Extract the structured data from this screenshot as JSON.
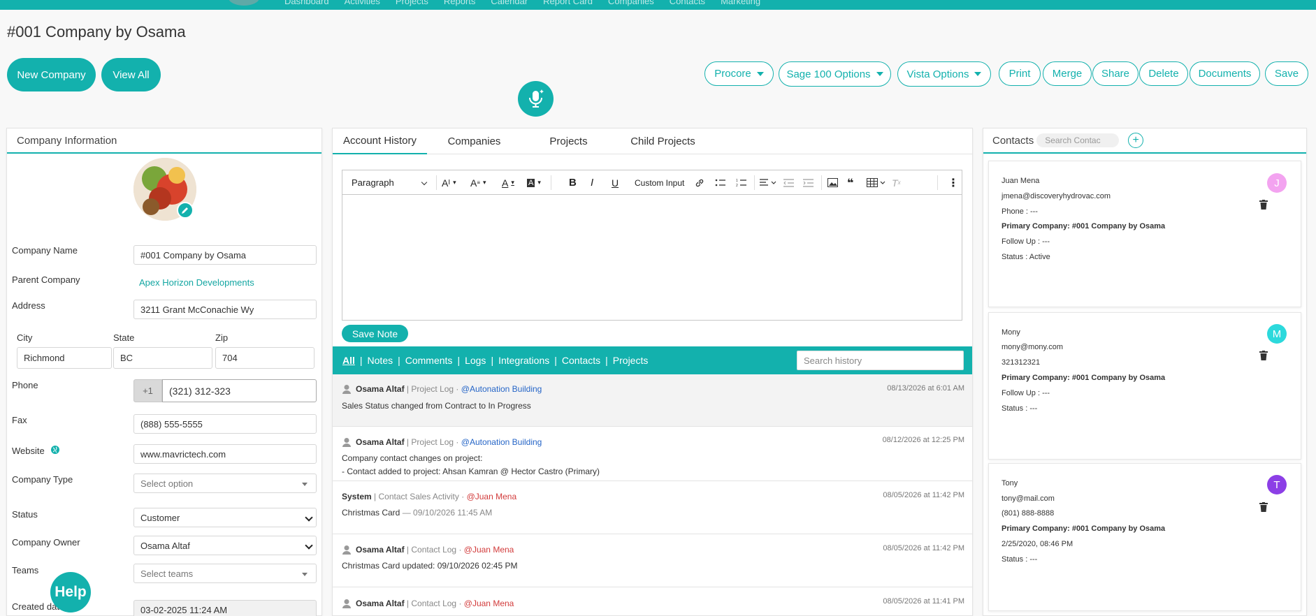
{
  "topbar": {
    "nav": [
      "Dashboard",
      "Activities",
      "Projects",
      "Reports",
      "Calendar",
      "Report Card",
      "Companies",
      "Contacts",
      "Marketing"
    ]
  },
  "page_title": "#001 Company by Osama",
  "actions": {
    "new_company": "New Company",
    "view_all": "View All",
    "procore": "Procore",
    "sage": "Sage 100 Options",
    "vista": "Vista Options",
    "print": "Print",
    "merge": "Merge",
    "share": "Share",
    "delete": "Delete",
    "documents": "Documents",
    "save": "Save"
  },
  "company_info": {
    "header": "Company Information",
    "company_name_label": "Company Name",
    "company_name": "#001 Company by Osama",
    "parent_company_label": "Parent Company",
    "parent_company": "Apex Horizon Developments",
    "address_label": "Address",
    "address": "3211 Grant McConachie Wy",
    "city_label": "City",
    "city": "Richmond",
    "state_label": "State",
    "state": "BC",
    "zip_label": "Zip",
    "zip": "704",
    "phone_label": "Phone",
    "phone_prefix": "+1",
    "phone": "(321) 312-323",
    "fax_label": "Fax",
    "fax": "(888) 555-5555",
    "website_label": "Website",
    "website": "www.mavrictech.com",
    "company_type_label": "Company Type",
    "company_type_placeholder": "Select option",
    "status_label": "Status",
    "status": "Customer",
    "owner_label": "Company Owner",
    "owner": "Osama Altaf",
    "teams_label": "Teams",
    "teams_placeholder": "Select teams",
    "created_label": "Created dat",
    "created": "03-02-2025 11:24 AM"
  },
  "mid": {
    "tabs": [
      "Account History",
      "Companies",
      "Projects",
      "Child Projects"
    ],
    "editor": {
      "paragraph": "Paragraph",
      "custom_input": "Custom Input"
    },
    "save_note": "Save Note",
    "filters": [
      "All",
      "Notes",
      "Comments",
      "Logs",
      "Integrations",
      "Contacts",
      "Projects"
    ],
    "search_placeholder": "Search history",
    "history": [
      {
        "name": "Osama Altaf",
        "kind": "Project Log",
        "ref": "@Autonation Building",
        "date": "08/13/2026 at 6:01 AM",
        "lines": [
          "Sales Status changed from Contract to In Progress"
        ]
      },
      {
        "name": "Osama Altaf",
        "kind": "Project Log",
        "ref": "@Autonation Building",
        "date": "08/12/2026 at 12:25 PM",
        "lines": [
          "Company contact changes on project:",
          "- Contact added to project: Ahsan Kamran @ Hector Castro (Primary)"
        ]
      },
      {
        "name": "System",
        "kind": "Contact Sales Activity",
        "ref": "@Juan Mena",
        "date": "08/05/2026 at 11:42 PM",
        "lines": [
          "Christmas Card",
          "— 09/10/2026 11:45 AM"
        ]
      },
      {
        "name": "Osama Altaf",
        "kind": "Contact Log",
        "ref": "@Juan Mena",
        "date": "08/05/2026 at 11:42 PM",
        "lines": [
          "Christmas Card updated: 09/10/2026 02:45 PM"
        ]
      },
      {
        "name": "Osama Altaf",
        "kind": "Contact Log",
        "ref": "@Juan Mena",
        "date": "08/05/2026 at 11:41 PM",
        "lines": []
      }
    ]
  },
  "contacts": {
    "header": "Contacts",
    "search_placeholder": "Search Contac",
    "cards": [
      {
        "name": "Juan Mena",
        "email": "jmena@discoveryhydrovac.com",
        "phone": "Phone : ---",
        "primary": "Primary Company: #001 Company by Osama",
        "follow": "Follow Up : ---",
        "status": "Status : Active",
        "initial": "J",
        "color": "#f3a3f0"
      },
      {
        "name": "Mony",
        "email": "mony@mony.com",
        "phone": "321312321",
        "primary": "Primary Company: #001 Company by Osama",
        "follow": "Follow Up : ---",
        "status": "Status : ---",
        "initial": "M",
        "color": "#2cd9dc"
      },
      {
        "name": "Tony",
        "email": "tony@mail.com",
        "phone": "(801) 888-8888",
        "primary": "Primary Company: #001 Company by Osama",
        "follow": "2/25/2020, 08:46 PM",
        "status": "Status : ---",
        "initial": "T",
        "color": "#8c3fe6"
      }
    ]
  },
  "help": "Help",
  "colors": {
    "accent": "#13b1ad",
    "link_blue": "#2565c7",
    "link_red": "#d23b3b"
  }
}
